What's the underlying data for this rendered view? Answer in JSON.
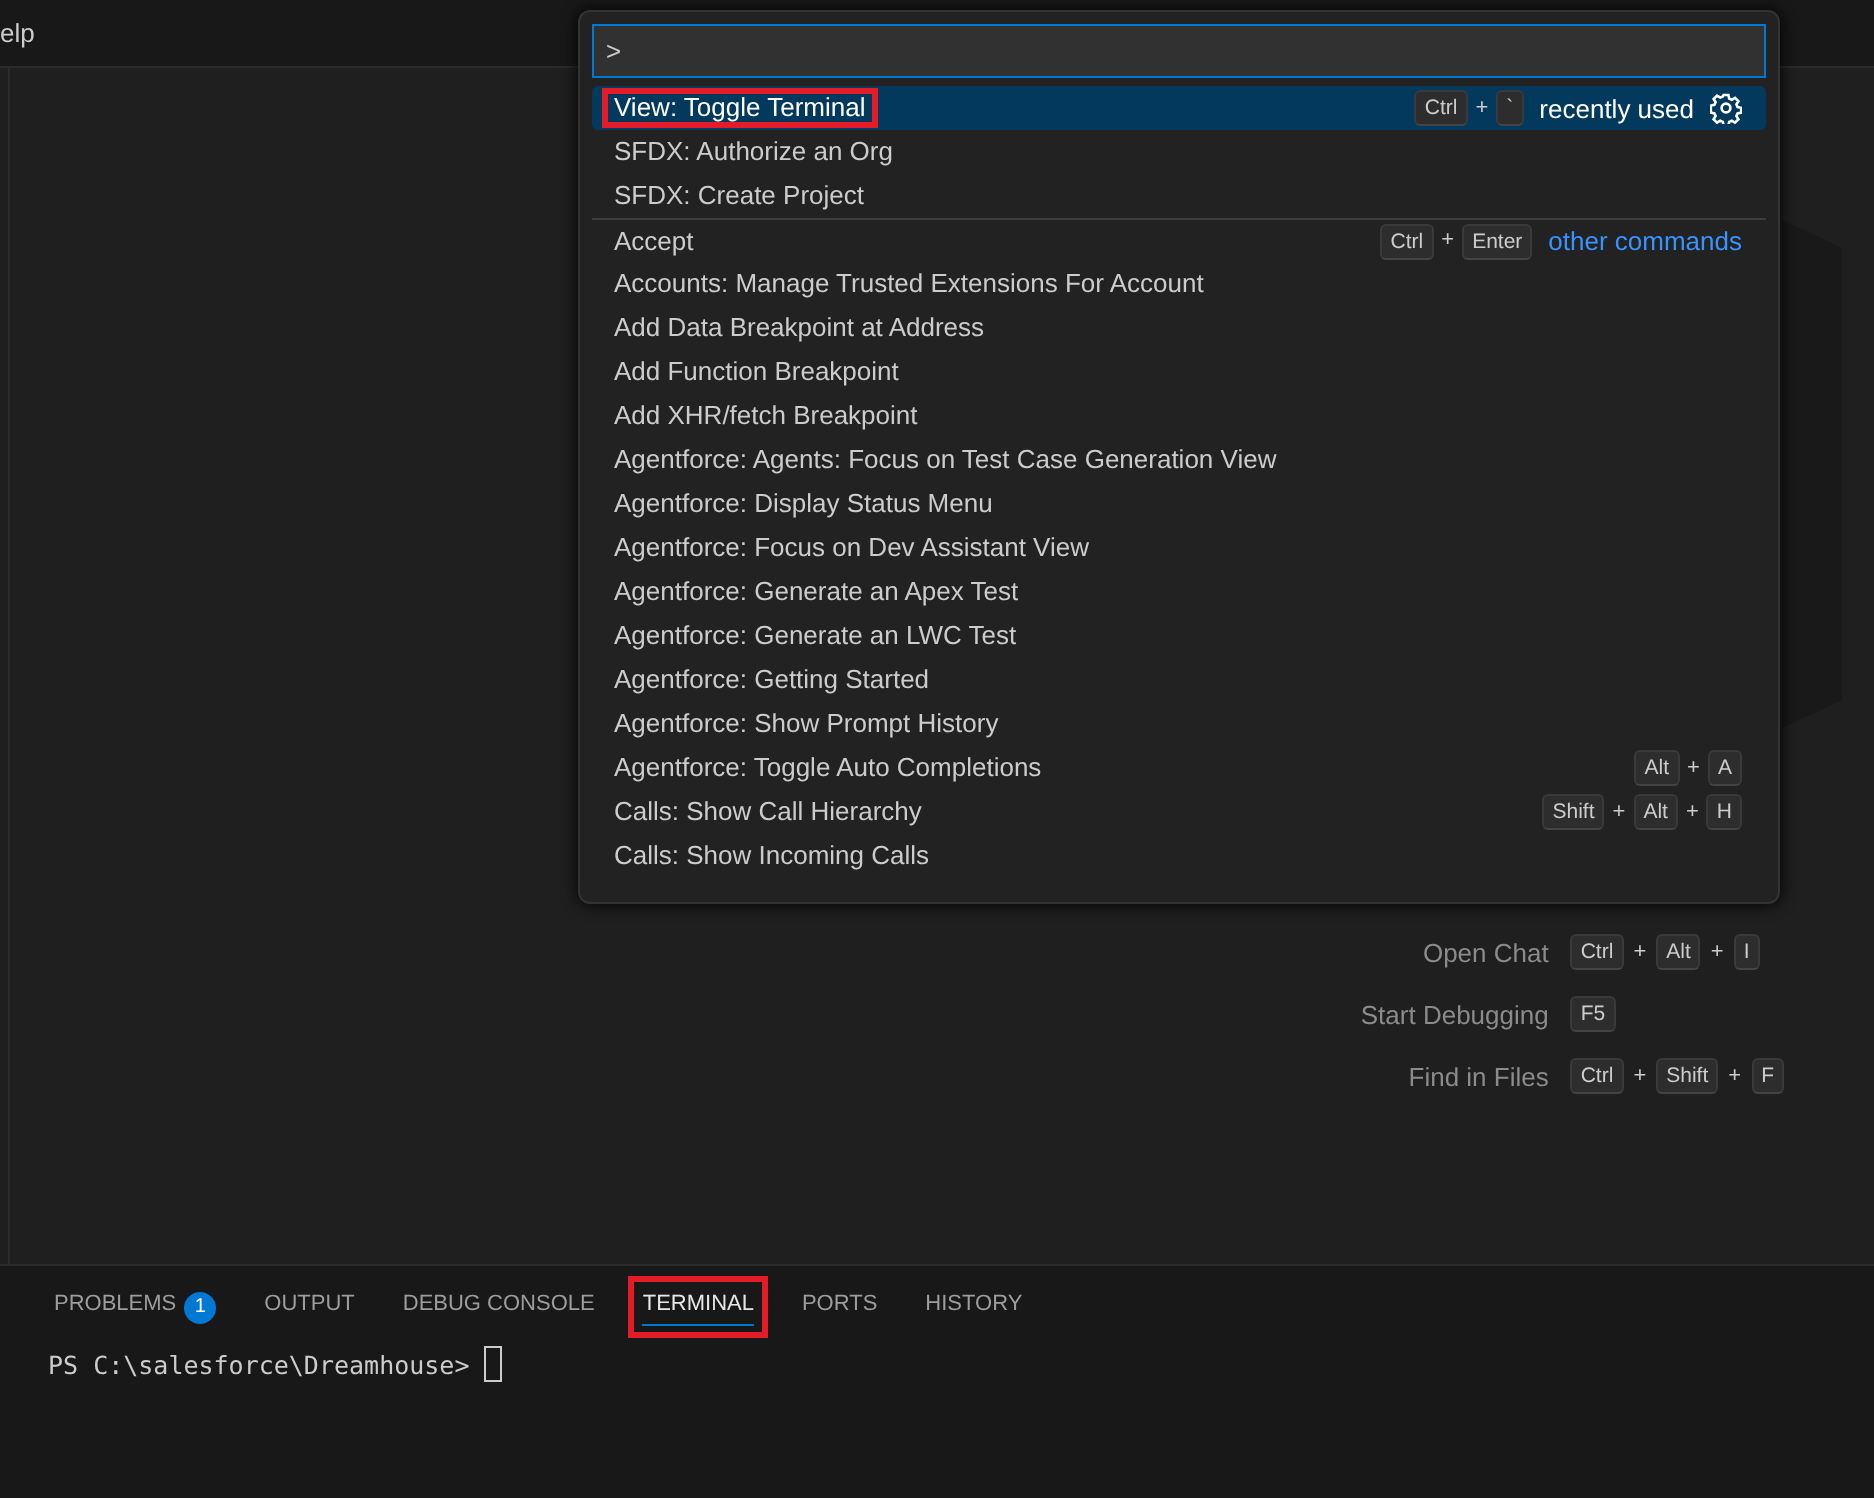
{
  "menu": {
    "label": "elp"
  },
  "command_palette": {
    "input": {
      "value": ">"
    },
    "commands": [
      {
        "label": "View: Toggle Terminal",
        "selected": true,
        "highlighted": true,
        "separator": false,
        "keys": [
          {
            "kind": "key",
            "text": "Ctrl"
          },
          {
            "kind": "plus",
            "text": "+"
          },
          {
            "kind": "key",
            "text": "`"
          }
        ],
        "group_label": "recently used",
        "settings": true
      },
      {
        "label": "SFDX: Authorize an Org",
        "selected": false,
        "highlighted": false,
        "separator": false
      },
      {
        "label": "SFDX: Create Project",
        "selected": false,
        "highlighted": false,
        "separator": false
      },
      {
        "label": "Accept",
        "selected": false,
        "highlighted": false,
        "separator": true,
        "keys": [
          {
            "kind": "key",
            "text": "Ctrl"
          },
          {
            "kind": "plus",
            "text": "+"
          },
          {
            "kind": "key",
            "text": "Enter"
          }
        ],
        "link_label": "other commands"
      },
      {
        "label": "Accounts: Manage Trusted Extensions For Account",
        "selected": false,
        "highlighted": false,
        "separator": false
      },
      {
        "label": "Add Data Breakpoint at Address",
        "selected": false,
        "highlighted": false,
        "separator": false
      },
      {
        "label": "Add Function Breakpoint",
        "selected": false,
        "highlighted": false,
        "separator": false
      },
      {
        "label": "Add XHR/fetch Breakpoint",
        "selected": false,
        "highlighted": false,
        "separator": false
      },
      {
        "label": "Agentforce: Agents: Focus on Test Case Generation View",
        "selected": false,
        "highlighted": false,
        "separator": false
      },
      {
        "label": "Agentforce: Display Status Menu",
        "selected": false,
        "highlighted": false,
        "separator": false
      },
      {
        "label": "Agentforce: Focus on Dev Assistant View",
        "selected": false,
        "highlighted": false,
        "separator": false
      },
      {
        "label": "Agentforce: Generate an Apex Test",
        "selected": false,
        "highlighted": false,
        "separator": false
      },
      {
        "label": "Agentforce: Generate an LWC Test",
        "selected": false,
        "highlighted": false,
        "separator": false
      },
      {
        "label": "Agentforce: Getting Started",
        "selected": false,
        "highlighted": false,
        "separator": false
      },
      {
        "label": "Agentforce: Show Prompt History",
        "selected": false,
        "highlighted": false,
        "separator": false
      },
      {
        "label": "Agentforce: Toggle Auto Completions",
        "selected": false,
        "highlighted": false,
        "separator": false,
        "keys": [
          {
            "kind": "key",
            "text": "Alt"
          },
          {
            "kind": "plus",
            "text": "+"
          },
          {
            "kind": "key",
            "text": "A"
          }
        ]
      },
      {
        "label": "Calls: Show Call Hierarchy",
        "selected": false,
        "highlighted": false,
        "separator": false,
        "keys": [
          {
            "kind": "key",
            "text": "Shift"
          },
          {
            "kind": "plus",
            "text": "+"
          },
          {
            "kind": "key",
            "text": "Alt"
          },
          {
            "kind": "plus",
            "text": "+"
          },
          {
            "kind": "key",
            "text": "H"
          }
        ]
      },
      {
        "label": "Calls: Show Incoming Calls",
        "selected": false,
        "highlighted": false,
        "separator": false
      }
    ]
  },
  "shortcuts": [
    {
      "label": "Open Chat",
      "keys": [
        {
          "kind": "key",
          "text": "Ctrl"
        },
        {
          "kind": "plus",
          "text": "+"
        },
        {
          "kind": "key",
          "text": "Alt"
        },
        {
          "kind": "plus",
          "text": "+"
        },
        {
          "kind": "key",
          "text": "I"
        }
      ]
    },
    {
      "label": "Start Debugging",
      "keys": [
        {
          "kind": "key",
          "text": "F5"
        }
      ]
    },
    {
      "label": "Find in Files",
      "keys": [
        {
          "kind": "key",
          "text": "Ctrl"
        },
        {
          "kind": "plus",
          "text": "+"
        },
        {
          "kind": "key",
          "text": "Shift"
        },
        {
          "kind": "plus",
          "text": "+"
        },
        {
          "kind": "key",
          "text": "F"
        }
      ]
    }
  ],
  "panel": {
    "tabs": [
      {
        "label": "PROBLEMS",
        "badge": "1",
        "selected": false,
        "highlighted": false
      },
      {
        "label": "OUTPUT",
        "selected": false,
        "highlighted": false
      },
      {
        "label": "DEBUG CONSOLE",
        "selected": false,
        "highlighted": false
      },
      {
        "label": "TERMINAL",
        "selected": true,
        "highlighted": true
      },
      {
        "label": "PORTS",
        "selected": false,
        "highlighted": false
      },
      {
        "label": "HISTORY",
        "selected": false,
        "highlighted": false
      }
    ],
    "terminal": {
      "prompt": "PS C:\\salesforce\\Dreamhouse>"
    }
  }
}
